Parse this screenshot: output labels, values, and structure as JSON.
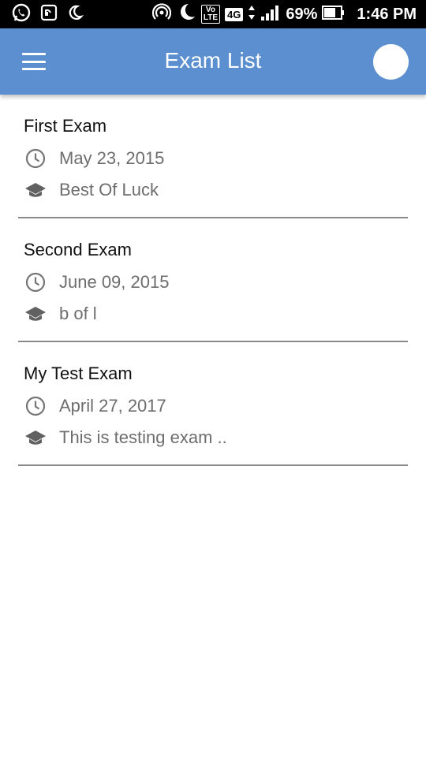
{
  "status_bar": {
    "volte_top": "Vo",
    "volte_bottom": "LTE",
    "network": "4G",
    "battery": "69%",
    "time": "1:46 PM"
  },
  "app_bar": {
    "title": "Exam List",
    "color": "#5b8fcf"
  },
  "icons": {
    "menu": "hamburger-menu-icon",
    "date": "clock-icon",
    "note": "graduation-cap-icon"
  },
  "exams": [
    {
      "title": "First Exam",
      "date": "May 23, 2015",
      "note": "Best Of Luck"
    },
    {
      "title": "Second Exam",
      "date": "June 09, 2015",
      "note": "b of l"
    },
    {
      "title": "My Test Exam",
      "date": "April 27, 2017",
      "note": "This is testing exam .."
    }
  ]
}
